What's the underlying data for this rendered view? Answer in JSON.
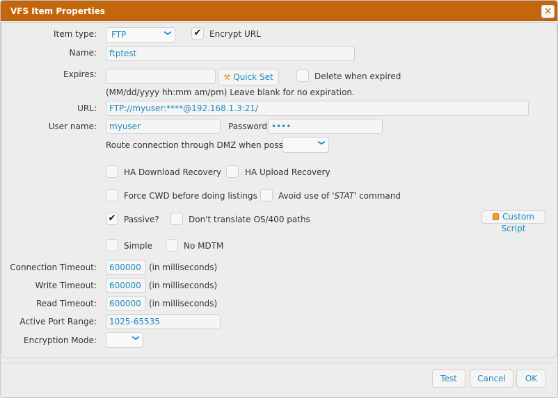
{
  "window": {
    "title": "VFS Item Properties",
    "close_icon": "×"
  },
  "item_type": {
    "label": "Item type:",
    "value": "FTP"
  },
  "encrypt_url": {
    "label": "Encrypt URL",
    "checked": true
  },
  "name": {
    "label": "Name:",
    "value": "ftptest"
  },
  "expires": {
    "label": "Expires:",
    "value": "",
    "quick_set_label": "Quick Set",
    "hint": "(MM/dd/yyyy hh:mm am/pm) Leave blank for no expiration."
  },
  "delete_when_expired": {
    "label": "Delete when expired",
    "checked": false
  },
  "url": {
    "label": "URL:",
    "value": "FTP://myuser:****@192.168.1.3:21/"
  },
  "user_name": {
    "label": "User name:",
    "value": "myuser"
  },
  "password": {
    "label": "Password:",
    "value": "••••"
  },
  "dmz": {
    "label": "Route connection through DMZ when possible:",
    "value": ""
  },
  "options": {
    "ha_download": {
      "label": "HA Download Recovery",
      "checked": false
    },
    "ha_upload": {
      "label": "HA Upload Recovery",
      "checked": false
    },
    "force_cwd": {
      "label": "Force CWD before doing listings",
      "checked": false
    },
    "avoid_stat_prefix": "Avoid use of '",
    "avoid_stat_cmd": "STAT",
    "avoid_stat_suffix": "' command",
    "passive": {
      "label": "Passive?",
      "checked": true
    },
    "no_translate": {
      "label": "Don't translate OS/400 paths",
      "checked": false
    },
    "simple": {
      "label": "Simple",
      "checked": false
    },
    "no_mdtm": {
      "label": "No MDTM",
      "checked": false
    }
  },
  "custom_script_label": "Custom Script",
  "connection_timeout": {
    "label": "Connection Timeout:",
    "value": "600000",
    "unit": "(in milliseconds)"
  },
  "write_timeout": {
    "label": "Write Timeout:",
    "value": "600000",
    "unit": "(in milliseconds)"
  },
  "read_timeout": {
    "label": "Read Timeout:",
    "value": "600000",
    "unit": "(in milliseconds)"
  },
  "active_port_range": {
    "label": "Active Port Range:",
    "value": "1025-65535"
  },
  "encryption_mode": {
    "label": "Encryption Mode:",
    "value": ""
  },
  "footer": {
    "test": "Test",
    "cancel": "Cancel",
    "ok": "OK"
  },
  "icons": {
    "check": "✔",
    "chevron": "❯",
    "wrench": "🔧"
  }
}
